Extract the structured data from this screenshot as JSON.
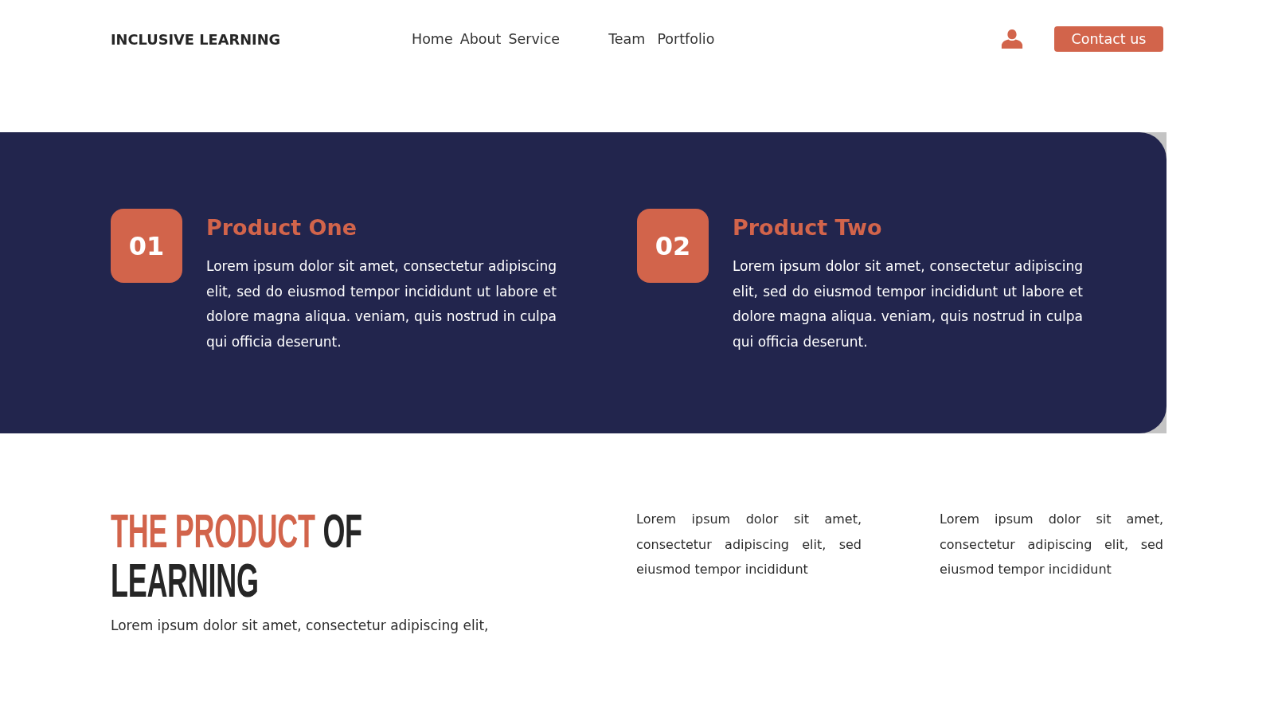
{
  "header": {
    "logo": "INCLUSIVE LEARNING",
    "nav": [
      "Home",
      "About",
      "Service",
      "Team",
      "Portfolio"
    ],
    "contact_button": "Contact us"
  },
  "products": [
    {
      "number": "01",
      "title": "Product One",
      "text": "Lorem ipsum dolor sit amet, consectetur adipiscing elit, sed do eiusmod tempor incididunt ut labore et dolore magna aliqua. veniam, quis nostrud in culpa qui officia deserunt."
    },
    {
      "number": "02",
      "title": "Product Two",
      "text": "Lorem ipsum dolor sit amet, consectetur adipiscing elit, sed do eiusmod tempor incididunt ut labore et dolore magna aliqua. veniam, quis nostrud in culpa qui officia deserunt."
    }
  ],
  "about": {
    "heading": {
      "accent": "THE PRODUCT",
      "rest": "OF LEARNING"
    },
    "intro": "Lorem ipsum dolor sit amet, consectetur adipiscing elit,",
    "columns": [
      "Lorem ipsum dolor sit amet, consectetur adipiscing elit, sed eiusmod tempor incididunt",
      "Lorem ipsum dolor sit amet, consectetur adipiscing elit, sed eiusmod tempor incididunt"
    ]
  }
}
